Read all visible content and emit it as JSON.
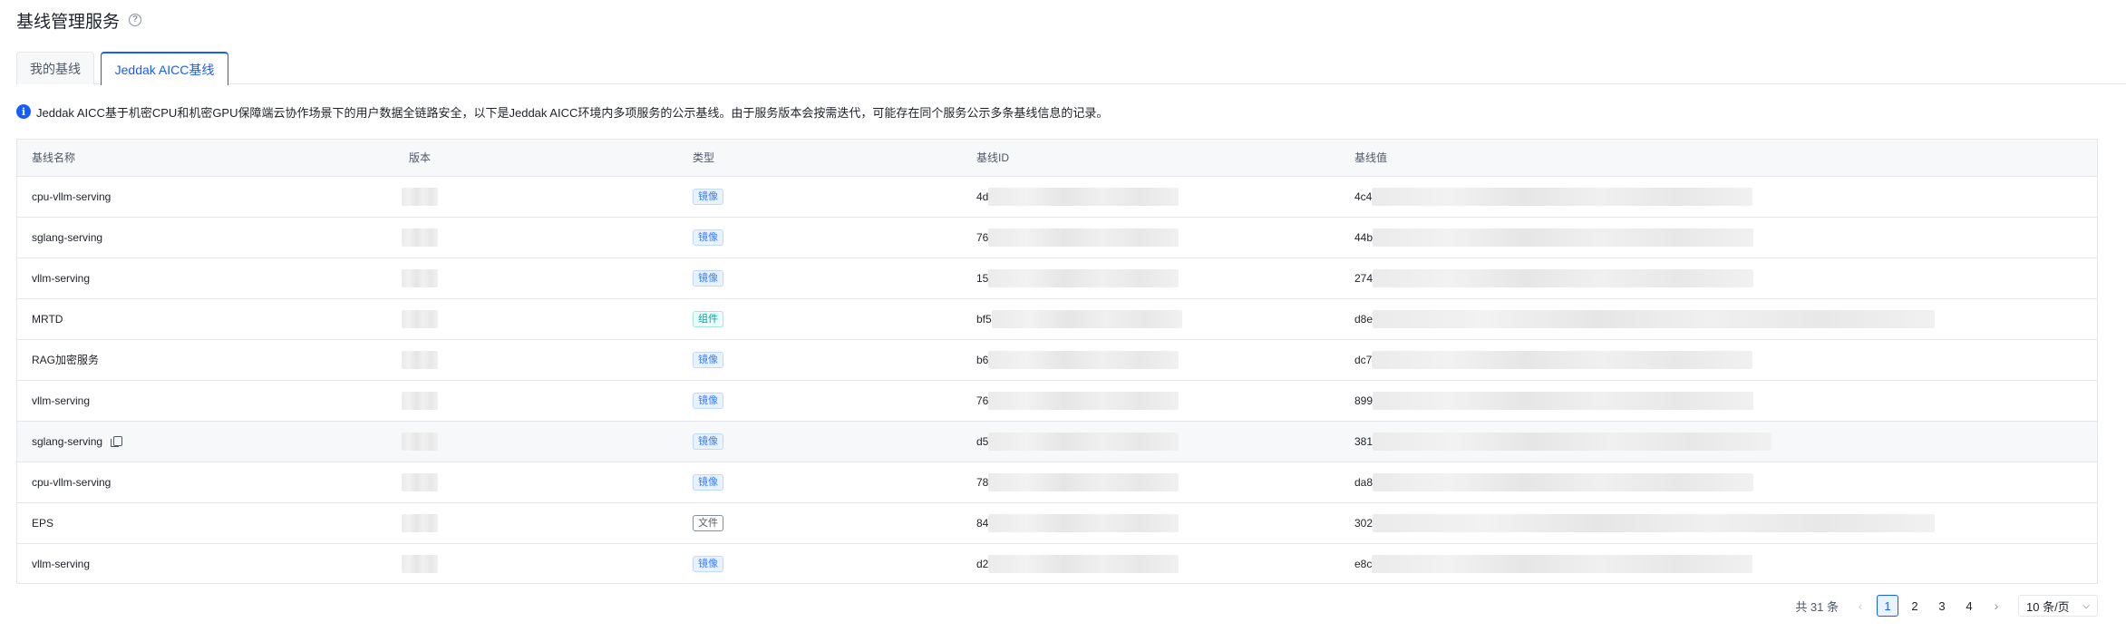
{
  "header": {
    "title": "基线管理服务",
    "help_icon": "question-circle-icon"
  },
  "tabs": [
    {
      "label": "我的基线",
      "active": false
    },
    {
      "label": "Jeddak AICC基线",
      "active": true
    }
  ],
  "notice": {
    "icon": "info-icon",
    "text": "Jeddak AICC基于机密CPU和机密GPU保障端云协作场景下的用户数据全链路安全，以下是Jeddak AICC环境内多项服务的公示基线。由于服务版本会按需迭代，可能存在同个服务公示多条基线信息的记录。"
  },
  "table": {
    "columns": [
      "基线名称",
      "版本",
      "类型",
      "基线ID",
      "基线值"
    ],
    "rows": [
      {
        "name": "cpu-vllm-serving",
        "type": "镜像",
        "type_kind": "image",
        "id_prefix": "4d",
        "value_prefix": "4c4"
      },
      {
        "name": "sglang-serving",
        "type": "镜像",
        "type_kind": "image",
        "id_prefix": "76",
        "value_prefix": "44b"
      },
      {
        "name": "vllm-serving",
        "type": "镜像",
        "type_kind": "image",
        "id_prefix": "15",
        "value_prefix": "274"
      },
      {
        "name": "MRTD",
        "type": "组件",
        "type_kind": "component",
        "id_prefix": "bf5",
        "value_prefix": "d8e"
      },
      {
        "name": "RAG加密服务",
        "type": "镜像",
        "type_kind": "image",
        "id_prefix": "b6",
        "value_prefix": "dc7"
      },
      {
        "name": "vllm-serving",
        "type": "镜像",
        "type_kind": "image",
        "id_prefix": "76",
        "value_prefix": "899"
      },
      {
        "name": "sglang-serving",
        "type": "镜像",
        "type_kind": "image",
        "id_prefix": "d5",
        "value_prefix": "381"
      },
      {
        "name": "cpu-vllm-serving",
        "type": "镜像",
        "type_kind": "image",
        "id_prefix": "78",
        "value_prefix": "da8"
      },
      {
        "name": "EPS",
        "type": "文件",
        "type_kind": "file",
        "id_prefix": "84",
        "value_prefix": "302"
      },
      {
        "name": "vllm-serving",
        "type": "镜像",
        "type_kind": "image",
        "id_prefix": "d2",
        "value_prefix": "e8c"
      }
    ]
  },
  "pagination": {
    "total_text": "共 31 条",
    "pages": [
      "1",
      "2",
      "3",
      "4"
    ],
    "current_page": "1",
    "prev_icon": "chevron-left-icon",
    "next_icon": "chevron-right-icon",
    "page_size": "10 条/页",
    "page_size_icon": "chevron-down-icon"
  },
  "colors": {
    "accent": "#165dff",
    "image_tag": "#3c7eff",
    "component_tag": "#00a0a0"
  }
}
